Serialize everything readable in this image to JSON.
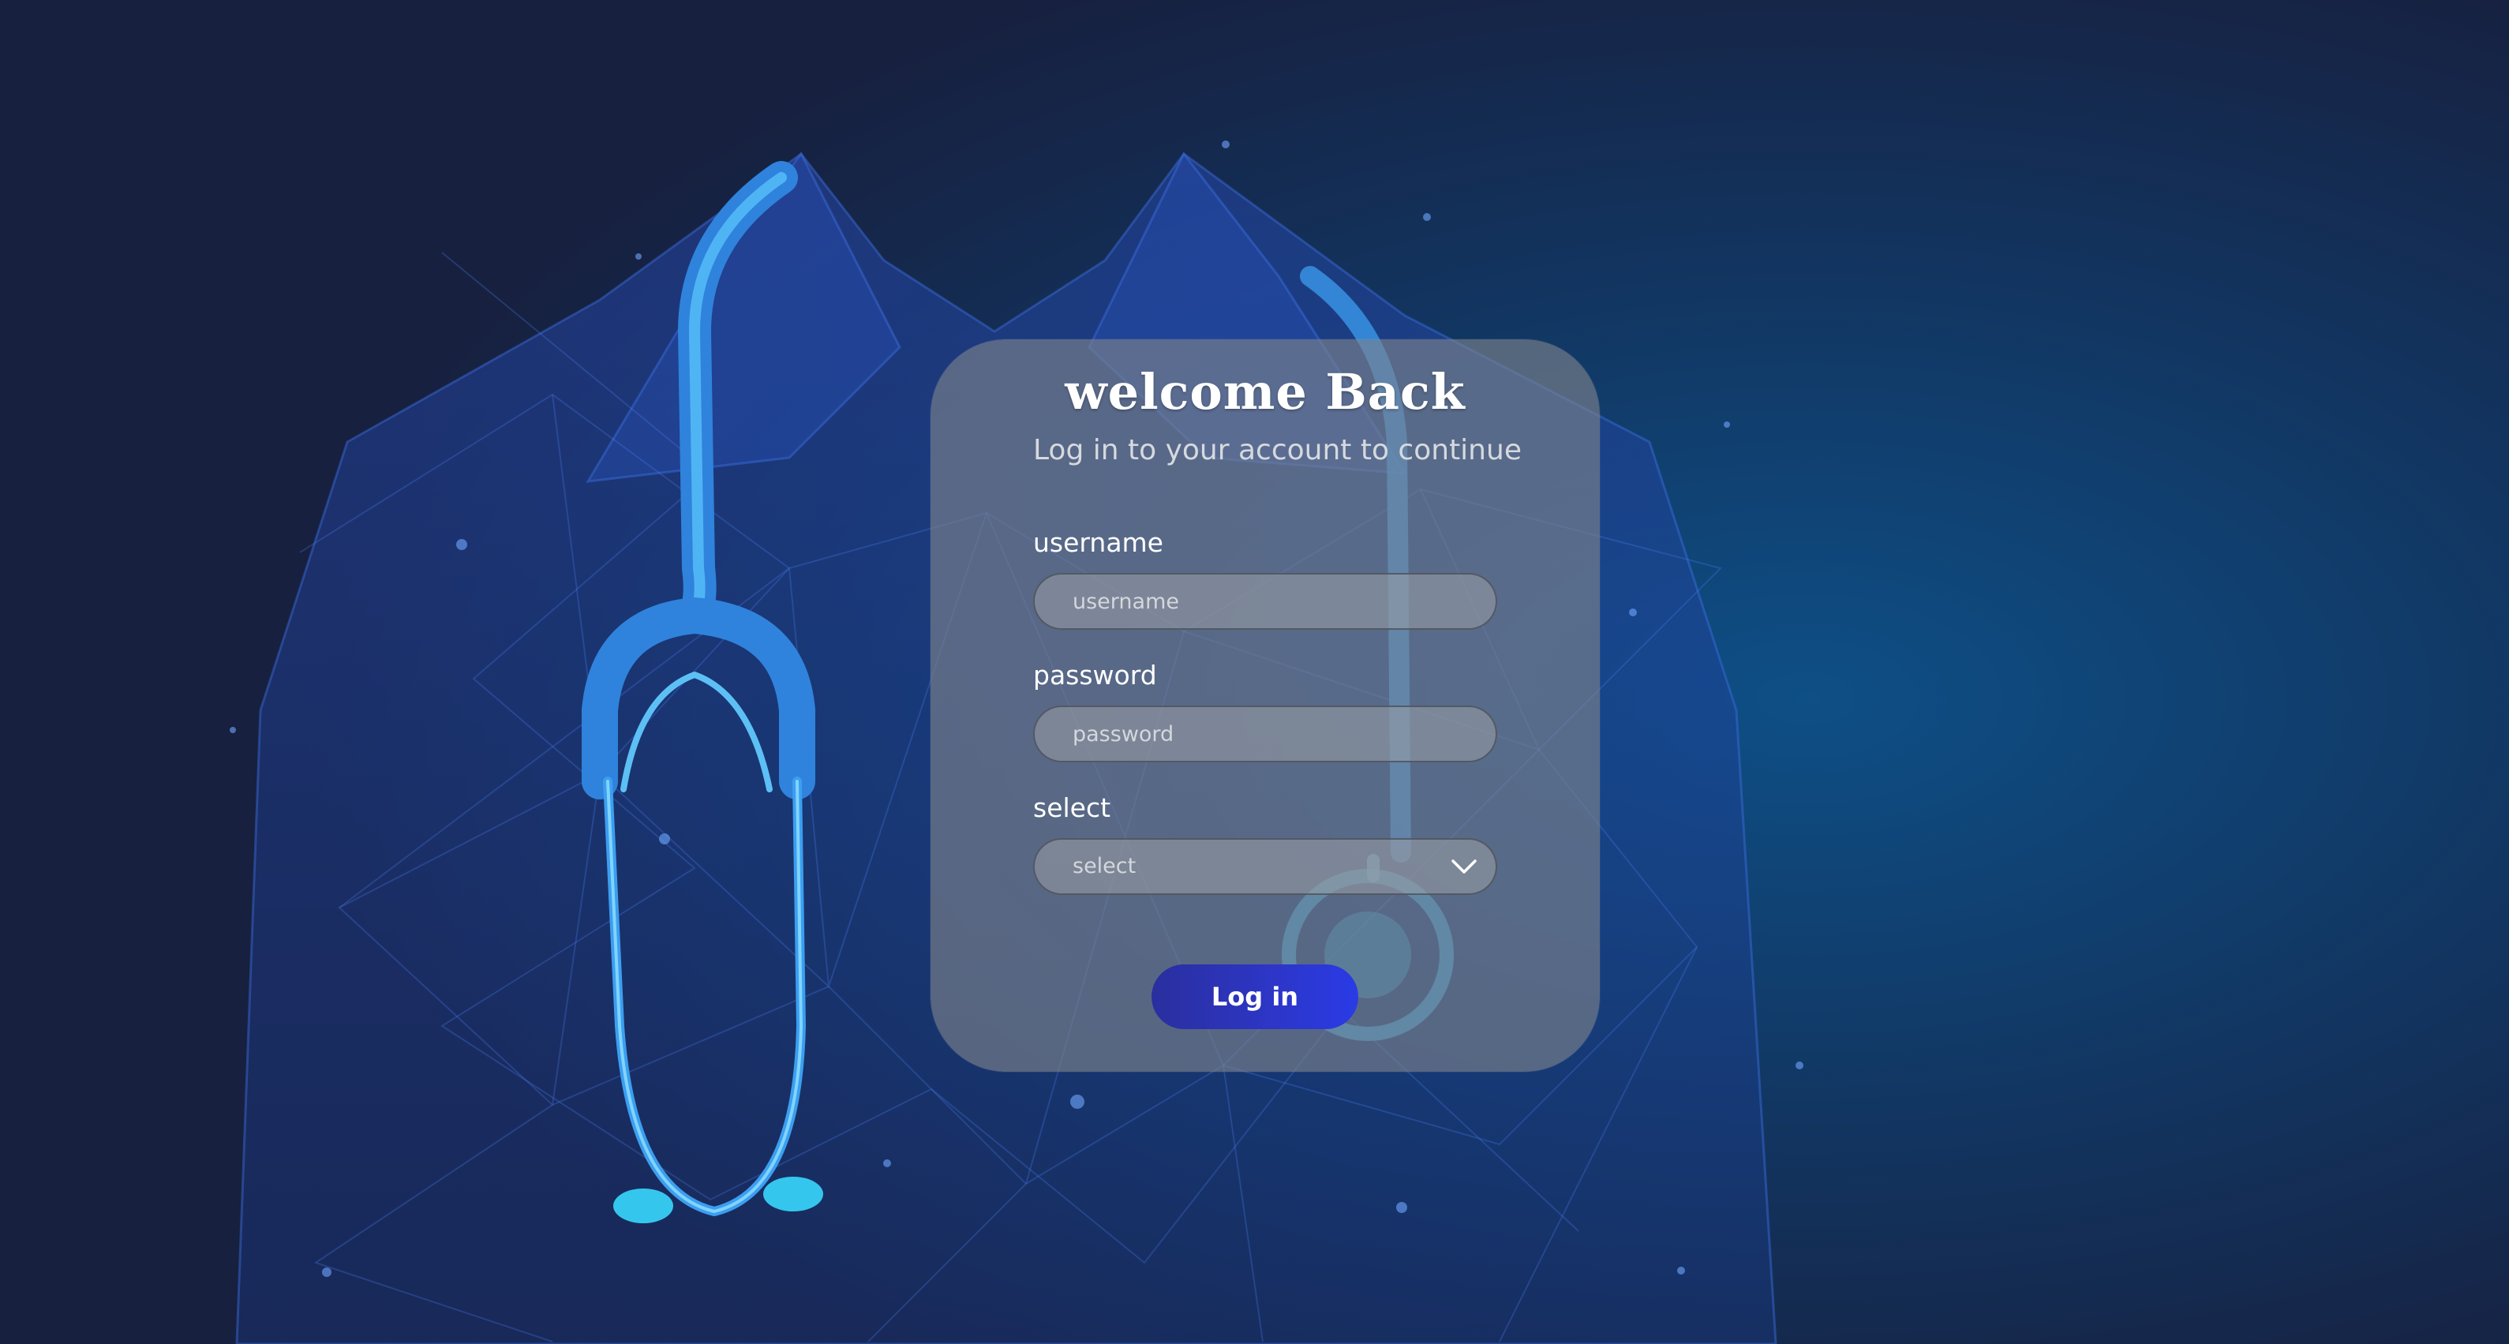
{
  "login": {
    "title": "welcome Back",
    "subtitle": "Log in to your account to continue",
    "username_label": "username",
    "username_placeholder": "username",
    "password_label": "password",
    "password_placeholder": "password",
    "select_label": "select",
    "select_value": "select",
    "submit_label": "Log in"
  },
  "icons": {
    "dropdown": "chevron-down-icon",
    "background": "stethoscope-icon"
  },
  "colors": {
    "background": "#16213f",
    "card": "#80848c",
    "button": "#2d36c8",
    "stethoscope": "#3aa6ee"
  }
}
